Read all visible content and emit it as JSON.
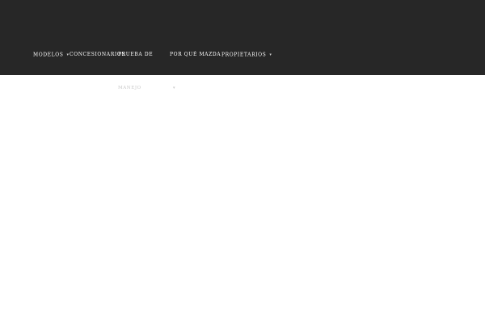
{
  "nav": {
    "items": [
      {
        "label": "Modelos",
        "caret": "▾"
      },
      {
        "label": "Concesionarios"
      },
      {
        "label": "Prueba de",
        "overflow_label": "Manejo",
        "caret": "▾"
      },
      {
        "label": "Por qué Mazda"
      },
      {
        "label": "Propietarios",
        "caret": "▾"
      }
    ]
  },
  "colors": {
    "header_background": "#272727",
    "nav_text": "#ffffff",
    "overflow_text": "#c8c8c8",
    "page_background": "#ffffff"
  }
}
